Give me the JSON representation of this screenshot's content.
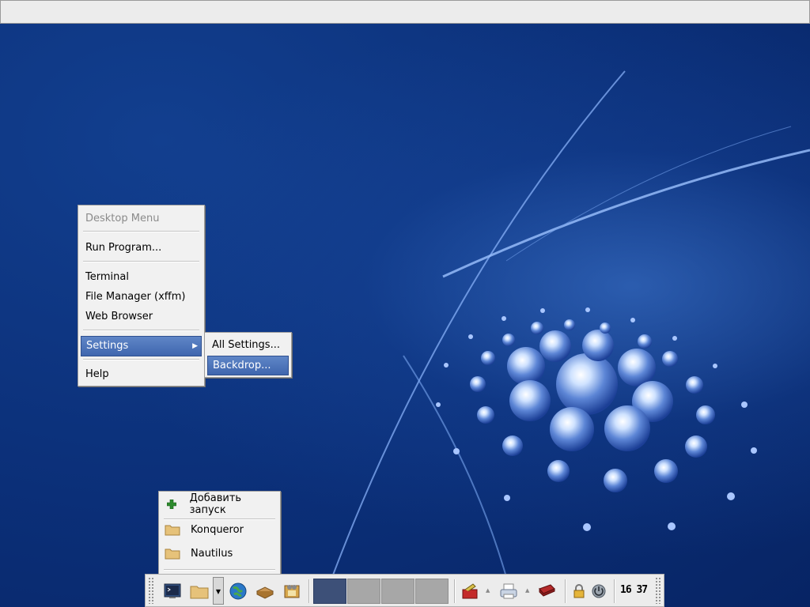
{
  "desktop_menu": {
    "title": "Desktop Menu",
    "items": [
      {
        "label": "Run Program..."
      },
      {
        "label": "Terminal"
      },
      {
        "label": "File Manager (xffm)"
      },
      {
        "label": "Web Browser"
      },
      {
        "label": "Settings"
      },
      {
        "label": "Help"
      }
    ]
  },
  "settings_submenu": {
    "items": [
      {
        "label": "All Settings..."
      },
      {
        "label": "Backdrop..."
      }
    ]
  },
  "launcher_popup": {
    "items": [
      {
        "label": "Добавить запуск",
        "icon": "plus-icon"
      },
      {
        "label": "Konqueror",
        "icon": "folder-icon"
      },
      {
        "label": "Nautilus",
        "icon": "folder-icon"
      }
    ]
  },
  "panel": {
    "clock": "16 37",
    "icons": [
      "terminal-icon",
      "folder-icon",
      "globe-icon",
      "package-icon",
      "media-icon",
      "toolbox-icon",
      "printer-icon",
      "book-icon",
      "lock-icon",
      "power-icon"
    ],
    "workspaces": 4,
    "active_workspace": 1
  },
  "colors": {
    "menu_highlight": "#4a70b6",
    "desktop_blue": "#0d3a86"
  }
}
